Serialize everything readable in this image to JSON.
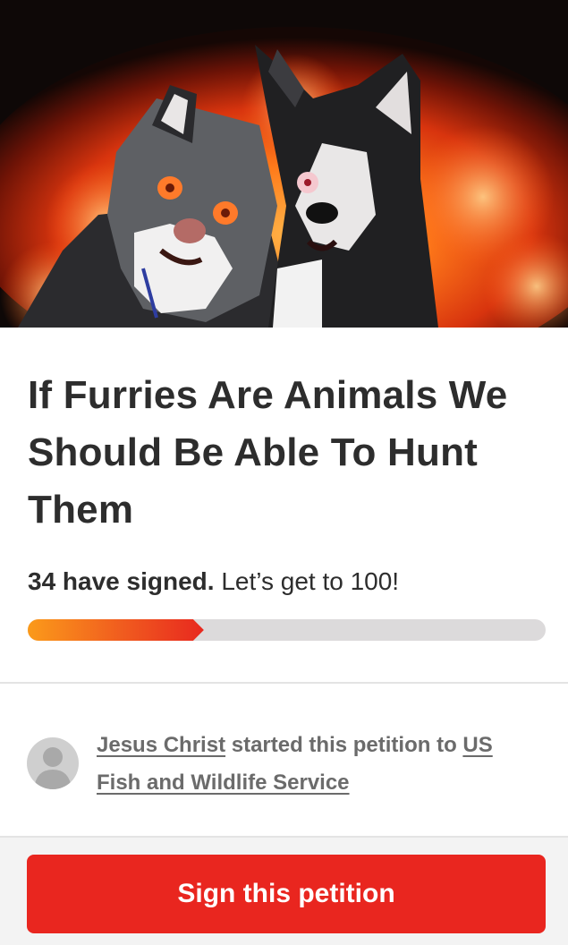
{
  "petition": {
    "title": "If Furries Are Animals We Should Be Able To Hunt Them",
    "signed_count_text": "34 have signed.",
    "goal_text": "Let’s get to 100!",
    "signatures": 34,
    "goal": 100
  },
  "starter": {
    "name": "Jesus Christ",
    "middle_text": "started this petition to",
    "target": "US Fish and Wildlife Service"
  },
  "actions": {
    "sign_label": "Sign this petition"
  },
  "colors": {
    "accent_red": "#e9261f",
    "progress_start": "#fb9a1a",
    "progress_track": "#dcdadb",
    "title_text": "#2d2d2d",
    "muted_text": "#6b6b6b"
  },
  "icons": {
    "avatar": "person-silhouette-icon"
  }
}
